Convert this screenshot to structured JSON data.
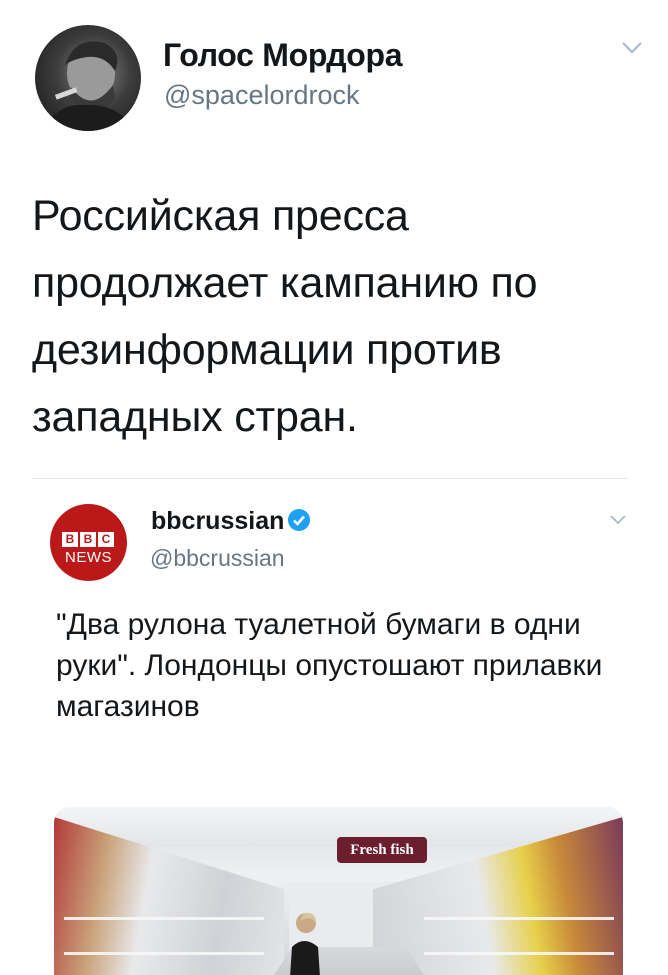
{
  "tweet": {
    "author_name": "Голос Мордора",
    "author_handle": "@spacelordrock",
    "text": "Российская пресса продолжает кампанию по дезинформации против западных стран.",
    "avatar_icon": "user-photo-avatar",
    "menu_icon": "chevron-down-icon"
  },
  "quoted_tweet": {
    "author_name": "bbcrussian",
    "author_handle": "@bbcrussian",
    "verified": true,
    "verified_icon": "verified-badge-icon",
    "avatar": {
      "logo_letters": [
        "B",
        "B",
        "C"
      ],
      "logo_subtitle": "NEWS",
      "color": "#bb1919"
    },
    "text": "\"Два рулона туалетной бумаги в одни руки\". Лондонцы опустошают прилавки магазинов",
    "media": {
      "sign_text": "Fresh fish",
      "description_icon": "supermarket-photo"
    }
  },
  "colors": {
    "text_primary": "#14171a",
    "text_secondary": "#657786",
    "verified_blue": "#1da1f2",
    "border": "#e1e8ed"
  }
}
